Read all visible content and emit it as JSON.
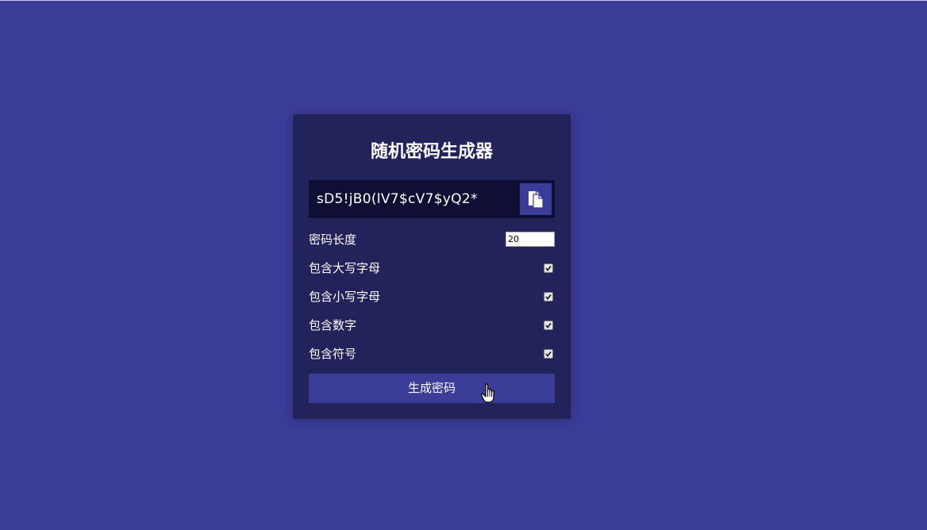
{
  "title": "随机密码生成器",
  "result": {
    "password": "sD5!jB0(lV7$cV7$yQ2*",
    "copy_icon": "clipboard-icon"
  },
  "length": {
    "label": "密码长度",
    "value": "20"
  },
  "options": [
    {
      "label": "包含大写字母",
      "checked": true
    },
    {
      "label": "包含小写字母",
      "checked": true
    },
    {
      "label": "包含数字",
      "checked": true
    },
    {
      "label": "包含符号",
      "checked": true
    }
  ],
  "generate_button": {
    "label": "生成密码"
  },
  "colors": {
    "background": "#3b3b98",
    "card": "#23235b",
    "result_bg": "#0f0f35",
    "accent": "#3b3b98"
  }
}
